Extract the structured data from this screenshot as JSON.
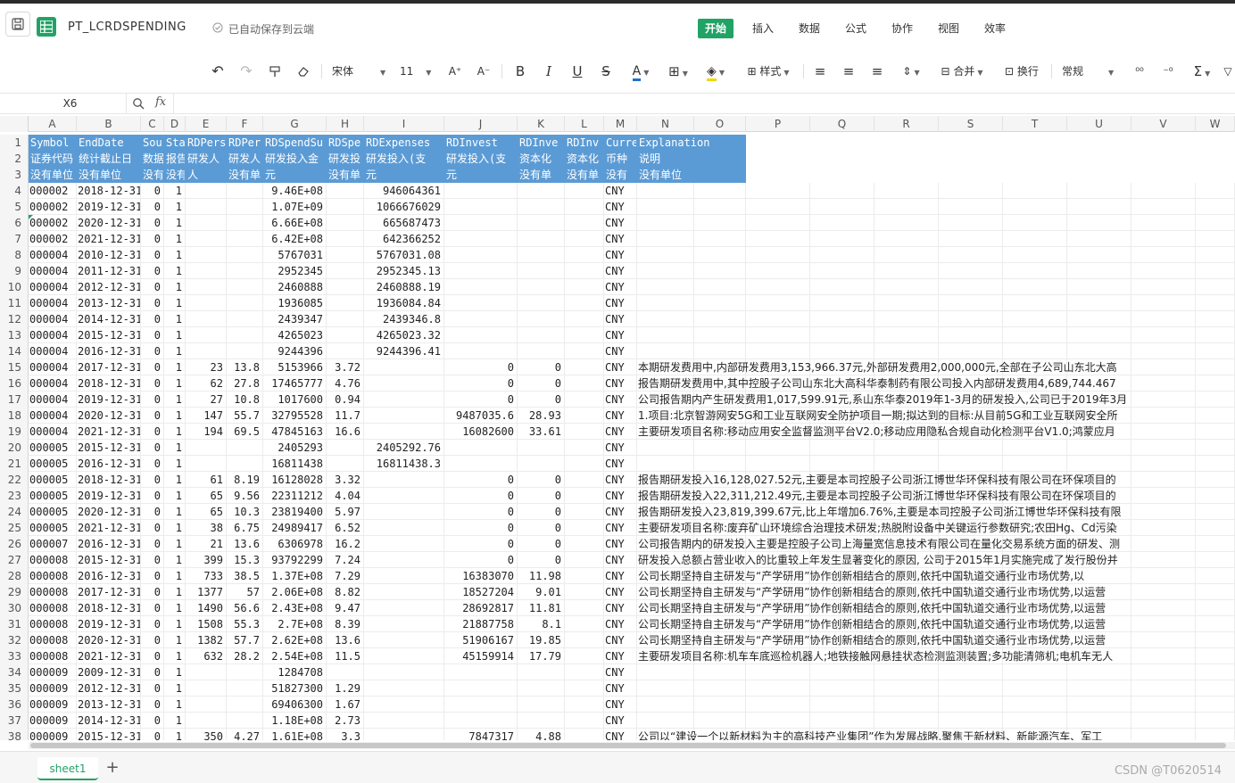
{
  "app": {
    "title": "PT_LCRDSPENDING",
    "save_status": "已自动保存到云端",
    "brand_color": "#21a366",
    "header_fill": "#5b9bd5"
  },
  "menu": [
    {
      "label": "开始",
      "active": true
    },
    {
      "label": "插入"
    },
    {
      "label": "数据"
    },
    {
      "label": "公式"
    },
    {
      "label": "协作"
    },
    {
      "label": "视图"
    },
    {
      "label": "效率"
    }
  ],
  "toolbar": {
    "undo_icon": "↶",
    "redo_icon": "↷",
    "format_painter_icon": "format-painter-icon",
    "clear_icon": "eraser-icon",
    "font_name": "宋体",
    "font_size": "11",
    "font_grow": "A⁺",
    "font_shrink": "A⁻",
    "bold": "B",
    "italic": "I",
    "underline": "U",
    "strike": "S",
    "font_color": "A",
    "border": "⊞",
    "fill": "◈",
    "style_label": "样式",
    "align_left": "≡",
    "align_center": "≡",
    "align_right": "≡",
    "valign": "⇕",
    "merge_label": "合并",
    "wrap_label": "换行",
    "number_format": "常规",
    "decimal": "⁰⁰",
    "decrease_decimal": "⁻⁰",
    "sum": "Σ",
    "filter": "▽"
  },
  "formula_bar": {
    "cell_ref": "X6",
    "fx": "fx",
    "value": ""
  },
  "columns": [
    "A",
    "B",
    "C",
    "D",
    "E",
    "F",
    "G",
    "H",
    "I",
    "J",
    "K",
    "L",
    "M",
    "N",
    "O",
    "P",
    "Q",
    "R",
    "S",
    "T",
    "U",
    "V",
    "W"
  ],
  "header_rows": [
    [
      "Symbol",
      "EndDate",
      "Sou",
      "Sta",
      "RDPers",
      "RDPer",
      "RDSpendSu",
      "RDSpe",
      "RDExpenses",
      "RDInvest",
      "RDInve",
      "RDInv",
      "Curre",
      "Explanation"
    ],
    [
      "证券代码",
      "统计截止日",
      "数据",
      "报告",
      "研发人",
      "研发人",
      "研发投入金",
      "研发投",
      "研发投入(支",
      "研发投入(支",
      "资本化",
      "资本化",
      "币种",
      "说明"
    ],
    [
      "没有单位",
      "没有单位",
      "没有",
      "没有",
      "人",
      "没有单",
      "元",
      "没有单",
      "元",
      "元",
      "没有单",
      "没有单",
      "没有",
      "没有单位"
    ]
  ],
  "rows": [
    {
      "n": 4,
      "a": "000002",
      "b": "2018-12-31",
      "c": "0",
      "d": "1",
      "e": "",
      "f": "",
      "g": "9.46E+08",
      "h": "",
      "i": "946064361",
      "j": "",
      "k": "",
      "l": "",
      "m": "CNY",
      "n2": ""
    },
    {
      "n": 5,
      "a": "000002",
      "b": "2019-12-31",
      "c": "0",
      "d": "1",
      "e": "",
      "f": "",
      "g": "1.07E+09",
      "h": "",
      "i": "1066676029",
      "j": "",
      "k": "",
      "l": "",
      "m": "CNY",
      "n2": ""
    },
    {
      "n": 6,
      "a": "000002",
      "b": "2020-12-31",
      "c": "0",
      "d": "1",
      "e": "",
      "f": "",
      "g": "6.66E+08",
      "h": "",
      "i": "665687473",
      "j": "",
      "k": "",
      "l": "",
      "m": "CNY",
      "n2": ""
    },
    {
      "n": 7,
      "a": "000002",
      "b": "2021-12-31",
      "c": "0",
      "d": "1",
      "e": "",
      "f": "",
      "g": "6.42E+08",
      "h": "",
      "i": "642366252",
      "j": "",
      "k": "",
      "l": "",
      "m": "CNY",
      "n2": ""
    },
    {
      "n": 8,
      "a": "000004",
      "b": "2010-12-31",
      "c": "0",
      "d": "1",
      "e": "",
      "f": "",
      "g": "5767031",
      "h": "",
      "i": "5767031.08",
      "j": "",
      "k": "",
      "l": "",
      "m": "CNY",
      "n2": ""
    },
    {
      "n": 9,
      "a": "000004",
      "b": "2011-12-31",
      "c": "0",
      "d": "1",
      "e": "",
      "f": "",
      "g": "2952345",
      "h": "",
      "i": "2952345.13",
      "j": "",
      "k": "",
      "l": "",
      "m": "CNY",
      "n2": ""
    },
    {
      "n": 10,
      "a": "000004",
      "b": "2012-12-31",
      "c": "0",
      "d": "1",
      "e": "",
      "f": "",
      "g": "2460888",
      "h": "",
      "i": "2460888.19",
      "j": "",
      "k": "",
      "l": "",
      "m": "CNY",
      "n2": ""
    },
    {
      "n": 11,
      "a": "000004",
      "b": "2013-12-31",
      "c": "0",
      "d": "1",
      "e": "",
      "f": "",
      "g": "1936085",
      "h": "",
      "i": "1936084.84",
      "j": "",
      "k": "",
      "l": "",
      "m": "CNY",
      "n2": ""
    },
    {
      "n": 12,
      "a": "000004",
      "b": "2014-12-31",
      "c": "0",
      "d": "1",
      "e": "",
      "f": "",
      "g": "2439347",
      "h": "",
      "i": "2439346.8",
      "j": "",
      "k": "",
      "l": "",
      "m": "CNY",
      "n2": ""
    },
    {
      "n": 13,
      "a": "000004",
      "b": "2015-12-31",
      "c": "0",
      "d": "1",
      "e": "",
      "f": "",
      "g": "4265023",
      "h": "",
      "i": "4265023.32",
      "j": "",
      "k": "",
      "l": "",
      "m": "CNY",
      "n2": ""
    },
    {
      "n": 14,
      "a": "000004",
      "b": "2016-12-31",
      "c": "0",
      "d": "1",
      "e": "",
      "f": "",
      "g": "9244396",
      "h": "",
      "i": "9244396.41",
      "j": "",
      "k": "",
      "l": "",
      "m": "CNY",
      "n2": ""
    },
    {
      "n": 15,
      "a": "000004",
      "b": "2017-12-31",
      "c": "0",
      "d": "1",
      "e": "23",
      "f": "13.8",
      "g": "5153966",
      "h": "3.72",
      "i": "",
      "j": "0",
      "k": "0",
      "l": "",
      "m": "CNY",
      "n2": "本期研发费用中,内部研发费用3,153,966.37元,外部研发费用2,000,000元,全部在子公司山东北大高"
    },
    {
      "n": 16,
      "a": "000004",
      "b": "2018-12-31",
      "c": "0",
      "d": "1",
      "e": "62",
      "f": "27.8",
      "g": "17465777",
      "h": "4.76",
      "i": "",
      "j": "0",
      "k": "0",
      "l": "",
      "m": "CNY",
      "n2": "报告期研发费用中,其中控股子公司山东北大高科华泰制药有限公司投入内部研发费用4,689,744.467"
    },
    {
      "n": 17,
      "a": "000004",
      "b": "2019-12-31",
      "c": "0",
      "d": "1",
      "e": "27",
      "f": "10.8",
      "g": "1017600",
      "h": "0.94",
      "i": "",
      "j": "0",
      "k": "0",
      "l": "",
      "m": "CNY",
      "n2": "公司报告期内产生研发费用1,017,599.91元,系山东华泰2019年1-3月的研发投入,公司已于2019年3月"
    },
    {
      "n": 18,
      "a": "000004",
      "b": "2020-12-31",
      "c": "0",
      "d": "1",
      "e": "147",
      "f": "55.7",
      "g": "32795528",
      "h": "11.7",
      "i": "",
      "j": "9487035.6",
      "k": "28.93",
      "l": "",
      "m": "CNY",
      "n2": "1.项目:北京智游网安5G和工业互联网安全防护项目一期;拟达到的目标:从目前5G和工业互联网安全所"
    },
    {
      "n": 19,
      "a": "000004",
      "b": "2021-12-31",
      "c": "0",
      "d": "1",
      "e": "194",
      "f": "69.5",
      "g": "47845163",
      "h": "16.6",
      "i": "",
      "j": "16082600",
      "k": "33.61",
      "l": "",
      "m": "CNY",
      "n2": "主要研发项目名称:移动应用安全监督监测平台V2.0;移动应用隐私合规自动化检测平台V1.0;鸿蒙应月"
    },
    {
      "n": 20,
      "a": "000005",
      "b": "2015-12-31",
      "c": "0",
      "d": "1",
      "e": "",
      "f": "",
      "g": "2405293",
      "h": "",
      "i": "2405292.76",
      "j": "",
      "k": "",
      "l": "",
      "m": "CNY",
      "n2": ""
    },
    {
      "n": 21,
      "a": "000005",
      "b": "2016-12-31",
      "c": "0",
      "d": "1",
      "e": "",
      "f": "",
      "g": "16811438",
      "h": "",
      "i": "16811438.3",
      "j": "",
      "k": "",
      "l": "",
      "m": "CNY",
      "n2": ""
    },
    {
      "n": 22,
      "a": "000005",
      "b": "2018-12-31",
      "c": "0",
      "d": "1",
      "e": "61",
      "f": "8.19",
      "g": "16128028",
      "h": "3.32",
      "i": "",
      "j": "0",
      "k": "0",
      "l": "",
      "m": "CNY",
      "n2": "报告期研发投入16,128,027.52元,主要是本司控股子公司浙江博世华环保科技有限公司在环保项目的"
    },
    {
      "n": 23,
      "a": "000005",
      "b": "2019-12-31",
      "c": "0",
      "d": "1",
      "e": "65",
      "f": "9.56",
      "g": "22311212",
      "h": "4.04",
      "i": "",
      "j": "0",
      "k": "0",
      "l": "",
      "m": "CNY",
      "n2": "报告期研发投入22,311,212.49元,主要是本司控股子公司浙江博世华环保科技有限公司在环保项目的"
    },
    {
      "n": 24,
      "a": "000005",
      "b": "2020-12-31",
      "c": "0",
      "d": "1",
      "e": "65",
      "f": "10.3",
      "g": "23819400",
      "h": "5.97",
      "i": "",
      "j": "0",
      "k": "0",
      "l": "",
      "m": "CNY",
      "n2": "报告期研发投入23,819,399.67元,比上年增加6.76%,主要是本司控股子公司浙江博世华环保科技有限"
    },
    {
      "n": 25,
      "a": "000005",
      "b": "2021-12-31",
      "c": "0",
      "d": "1",
      "e": "38",
      "f": "6.75",
      "g": "24989417",
      "h": "6.52",
      "i": "",
      "j": "0",
      "k": "0",
      "l": "",
      "m": "CNY",
      "n2": "主要研发项目名称:废弃矿山环境综合治理技术研发;热脱附设备中关键运行参数研究;农田Hg、Cd污染"
    },
    {
      "n": 26,
      "a": "000007",
      "b": "2016-12-31",
      "c": "0",
      "d": "1",
      "e": "21",
      "f": "13.6",
      "g": "6306978",
      "h": "16.2",
      "i": "",
      "j": "0",
      "k": "0",
      "l": "",
      "m": "CNY",
      "n2": "公司报告期内的研发投入主要是控股子公司上海量宽信息技术有限公司在量化交易系统方面的研发、测"
    },
    {
      "n": 27,
      "a": "000008",
      "b": "2015-12-31",
      "c": "0",
      "d": "1",
      "e": "399",
      "f": "15.3",
      "g": "93792299",
      "h": "7.24",
      "i": "",
      "j": "0",
      "k": "0",
      "l": "",
      "m": "CNY",
      "n2": "研发投入总额占营业收入的比重较上年发生显著变化的原因, 公司于2015年1月实施完成了发行股份并"
    },
    {
      "n": 28,
      "a": "000008",
      "b": "2016-12-31",
      "c": "0",
      "d": "1",
      "e": "733",
      "f": "38.5",
      "g": "1.37E+08",
      "h": "7.29",
      "i": "",
      "j": "16383070",
      "k": "11.98",
      "l": "",
      "m": "CNY",
      "n2": "公司长期坚持自主研发与“产学研用”协作创新相结合的原则,依托中国轨道交通行业市场优势,以"
    },
    {
      "n": 29,
      "a": "000008",
      "b": "2017-12-31",
      "c": "0",
      "d": "1",
      "e": "1377",
      "f": "57",
      "g": "2.06E+08",
      "h": "8.82",
      "i": "",
      "j": "18527204",
      "k": "9.01",
      "l": "",
      "m": "CNY",
      "n2": "公司长期坚持自主研发与“产学研用”协作创新相结合的原则,依托中国轨道交通行业市场优势,以运营"
    },
    {
      "n": 30,
      "a": "000008",
      "b": "2018-12-31",
      "c": "0",
      "d": "1",
      "e": "1490",
      "f": "56.6",
      "g": "2.43E+08",
      "h": "9.47",
      "i": "",
      "j": "28692817",
      "k": "11.81",
      "l": "",
      "m": "CNY",
      "n2": "公司长期坚持自主研发与“产学研用”协作创新相结合的原则,依托中国轨道交通行业市场优势,以运营"
    },
    {
      "n": 31,
      "a": "000008",
      "b": "2019-12-31",
      "c": "0",
      "d": "1",
      "e": "1508",
      "f": "55.3",
      "g": "2.7E+08",
      "h": "8.39",
      "i": "",
      "j": "21887758",
      "k": "8.1",
      "l": "",
      "m": "CNY",
      "n2": "公司长期坚持自主研发与“产学研用”协作创新相结合的原则,依托中国轨道交通行业市场优势,以运营"
    },
    {
      "n": 32,
      "a": "000008",
      "b": "2020-12-31",
      "c": "0",
      "d": "1",
      "e": "1382",
      "f": "57.7",
      "g": "2.62E+08",
      "h": "13.6",
      "i": "",
      "j": "51906167",
      "k": "19.85",
      "l": "",
      "m": "CNY",
      "n2": "公司长期坚持自主研发与“产学研用”协作创新相结合的原则,依托中国轨道交通行业市场优势,以运营"
    },
    {
      "n": 33,
      "a": "000008",
      "b": "2021-12-31",
      "c": "0",
      "d": "1",
      "e": "632",
      "f": "28.2",
      "g": "2.54E+08",
      "h": "11.5",
      "i": "",
      "j": "45159914",
      "k": "17.79",
      "l": "",
      "m": "CNY",
      "n2": "主要研发项目名称:机车车底巡检机器人;地铁接触网悬挂状态检测监测装置;多功能清筛机;电机车无人"
    },
    {
      "n": 34,
      "a": "000009",
      "b": "2009-12-31",
      "c": "0",
      "d": "1",
      "e": "",
      "f": "",
      "g": "1284708",
      "h": "",
      "i": "",
      "j": "",
      "k": "",
      "l": "",
      "m": "CNY",
      "n2": ""
    },
    {
      "n": 35,
      "a": "000009",
      "b": "2012-12-31",
      "c": "0",
      "d": "1",
      "e": "",
      "f": "",
      "g": "51827300",
      "h": "1.29",
      "i": "",
      "j": "",
      "k": "",
      "l": "",
      "m": "CNY",
      "n2": ""
    },
    {
      "n": 36,
      "a": "000009",
      "b": "2013-12-31",
      "c": "0",
      "d": "1",
      "e": "",
      "f": "",
      "g": "69406300",
      "h": "1.67",
      "i": "",
      "j": "",
      "k": "",
      "l": "",
      "m": "CNY",
      "n2": ""
    },
    {
      "n": 37,
      "a": "000009",
      "b": "2014-12-31",
      "c": "0",
      "d": "1",
      "e": "",
      "f": "",
      "g": "1.18E+08",
      "h": "2.73",
      "i": "",
      "j": "",
      "k": "",
      "l": "",
      "m": "CNY",
      "n2": ""
    },
    {
      "n": 38,
      "a": "000009",
      "b": "2015-12-31",
      "c": "0",
      "d": "1",
      "e": "350",
      "f": "4.27",
      "g": "1.61E+08",
      "h": "3.3",
      "i": "",
      "j": "7847317",
      "k": "4.88",
      "l": "",
      "m": "CNY",
      "n2": "公司以“建设一个以新材料为主的高科技产业集团”作为发展战略,聚焦于新材料、新能源汽车、军工"
    }
  ],
  "sheets": {
    "tabs": [
      "sheet1"
    ],
    "add_label": "+"
  },
  "watermark": "CSDN @T0620514"
}
